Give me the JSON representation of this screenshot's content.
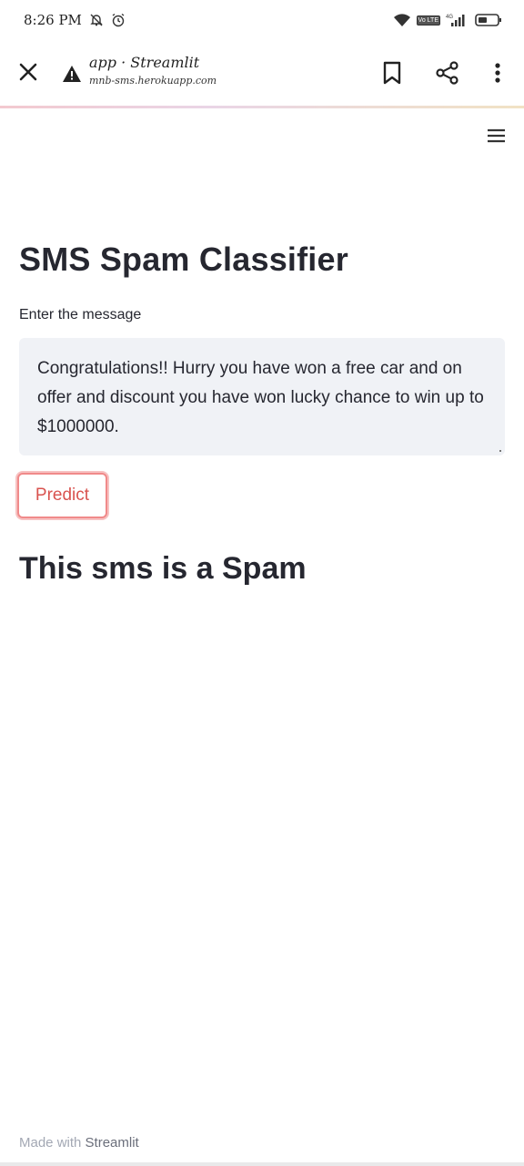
{
  "status_bar": {
    "time": "8:26 PM",
    "volte": "Vo LTE",
    "network": "4G"
  },
  "browser": {
    "page_title": "app · Streamlit",
    "url": "mnb-sms.herokuapp.com"
  },
  "app": {
    "title": "SMS Spam Classifier",
    "input_label": "Enter the message",
    "message_value": "Congratulations!! Hurry you have won a free car and on offer and discount you have won lucky chance to win up to $1000000.",
    "predict_label": "Predict",
    "result": "This sms is a Spam"
  },
  "footer": {
    "made_with": "Made with",
    "brand": "Streamlit"
  },
  "colors": {
    "accent": "#d9534f",
    "text": "#262730",
    "input_bg": "#f0f2f6"
  }
}
